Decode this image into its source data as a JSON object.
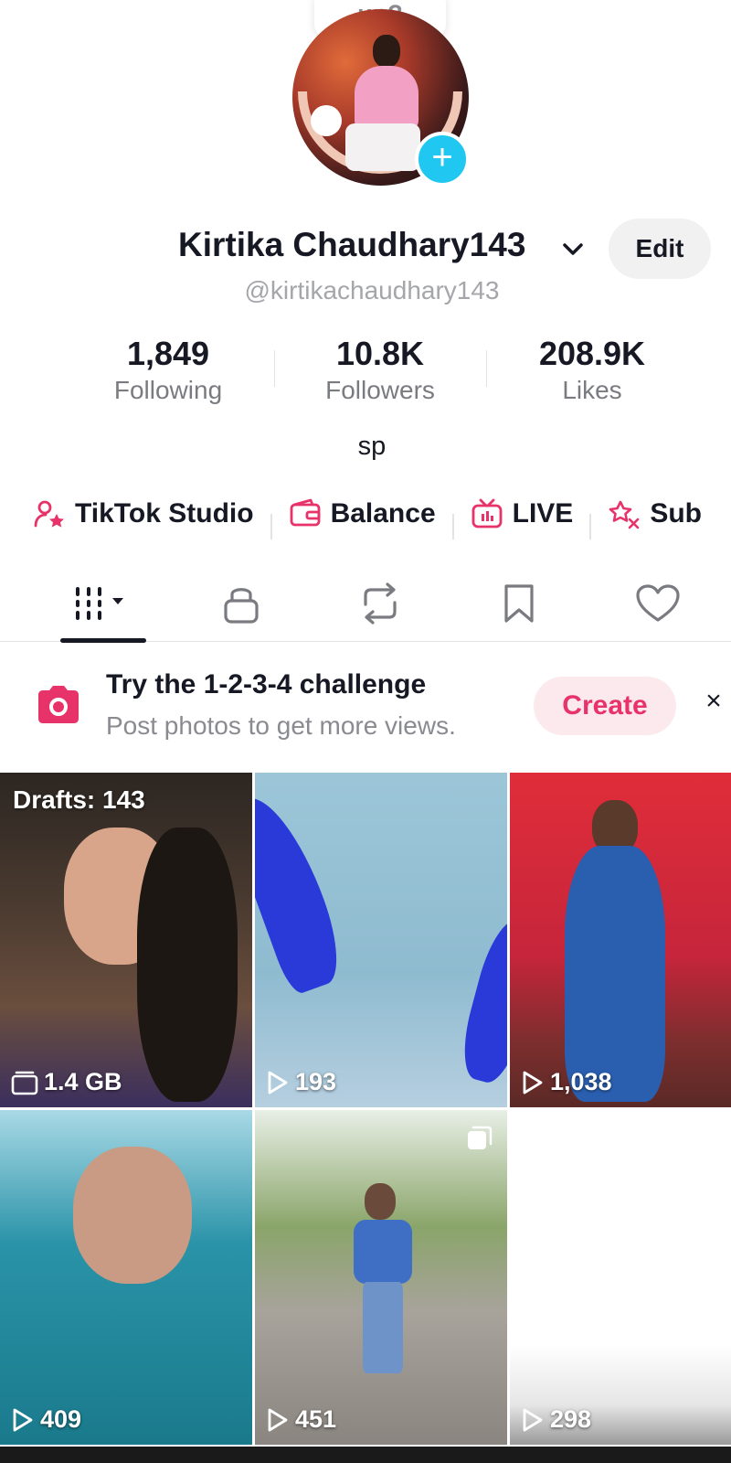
{
  "tooltip": {
    "text": "up?"
  },
  "profile": {
    "name": "Kirtika Chaudhary143",
    "handle": "@kirtikachaudhary143",
    "edit_label": "Edit",
    "bio": "sp"
  },
  "stats": [
    {
      "value": "1,849",
      "label": "Following"
    },
    {
      "value": "10.8K",
      "label": "Followers"
    },
    {
      "value": "208.9K",
      "label": "Likes"
    }
  ],
  "quick_links": [
    {
      "label": "TikTok Studio",
      "icon": "person-star-icon"
    },
    {
      "label": "Balance",
      "icon": "wallet-icon"
    },
    {
      "label": "LIVE",
      "icon": "tv-live-icon"
    },
    {
      "label": "Sub",
      "icon": "star-sub-icon"
    }
  ],
  "tabs": [
    {
      "name": "videos",
      "icon": "grid-icon",
      "selected": true
    },
    {
      "name": "private",
      "icon": "lock-icon"
    },
    {
      "name": "reposts",
      "icon": "repost-icon"
    },
    {
      "name": "favorites",
      "icon": "bookmark-icon"
    },
    {
      "name": "liked",
      "icon": "heart-icon"
    }
  ],
  "promo": {
    "title": "Try the 1-2-3-4 challenge",
    "subtitle": "Post photos to get more views.",
    "cta": "Create",
    "close": "×"
  },
  "videos": [
    {
      "top_label": "Drafts: 143",
      "count": "1.4 GB",
      "count_icon": "storage-icon"
    },
    {
      "count": "193",
      "count_icon": "play-icon"
    },
    {
      "count": "1,038",
      "count_icon": "play-icon"
    },
    {
      "count": "409",
      "count_icon": "play-icon"
    },
    {
      "count": "451",
      "count_icon": "play-icon",
      "badge": "multi-photo-icon"
    },
    {
      "count": "298",
      "count_icon": "play-icon"
    }
  ],
  "colors": {
    "accent": "#e8336a",
    "add_button": "#20c7f0",
    "text_primary": "#161823",
    "text_secondary": "#8a8b91"
  }
}
